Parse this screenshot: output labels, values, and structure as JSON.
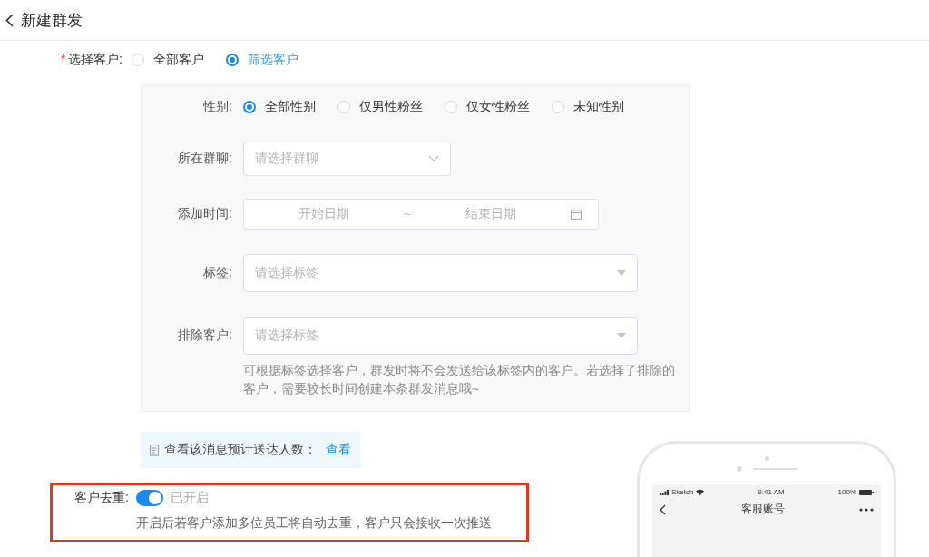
{
  "header": {
    "title": "新建群发"
  },
  "customer_select": {
    "required_mark": "*",
    "label": "选择客户:",
    "options": [
      {
        "label": "全部客户",
        "selected": false
      },
      {
        "label": "筛选客户",
        "selected": true
      }
    ]
  },
  "filters": {
    "gender": {
      "label": "性别:",
      "options": [
        {
          "label": "全部性别",
          "selected": true
        },
        {
          "label": "仅男性粉丝",
          "selected": false
        },
        {
          "label": "仅女性粉丝",
          "selected": false
        },
        {
          "label": "未知性别",
          "selected": false
        }
      ]
    },
    "group_chat": {
      "label": "所在群聊:",
      "placeholder": "请选择群聊"
    },
    "add_time": {
      "label": "添加时间:",
      "start_placeholder": "开始日期",
      "separator": "~",
      "end_placeholder": "结束日期"
    },
    "tags": {
      "label": "标签:",
      "placeholder": "请选择标签"
    },
    "exclude": {
      "label": "排除客户:",
      "placeholder": "请选择标签",
      "hint": "可根据标签选择客户，群发时将不会发送给该标签内的客户。若选择了排除的客户，需要较长时间创建本条群发消息哦~"
    }
  },
  "estimate": {
    "text": "查看该消息预计送达人数：",
    "link": "查看"
  },
  "dedupe": {
    "label": "客户去重:",
    "on": true,
    "state_text": "已开启",
    "hint": "开启后若客户添加多位员工将自动去重，客户只会接收一次推送"
  },
  "phone_preview": {
    "carrier": "Sketch",
    "time": "9:41 AM",
    "battery": "100%",
    "title": "客服账号"
  }
}
